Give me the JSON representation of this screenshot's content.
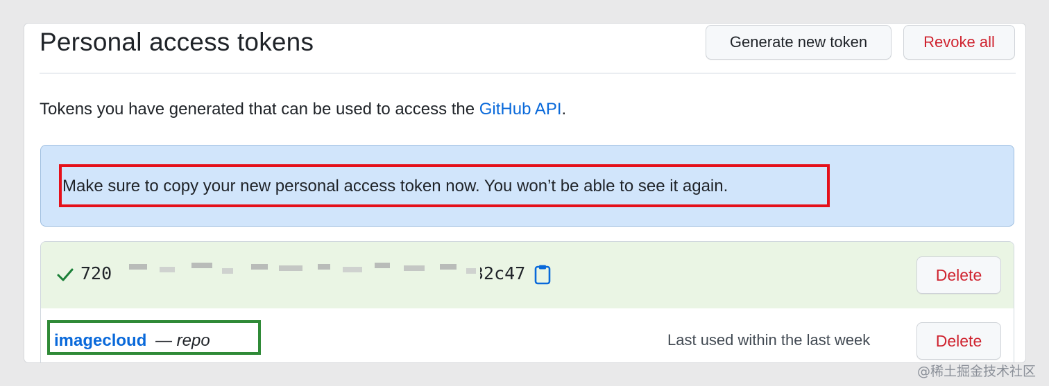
{
  "header": {
    "title": "Personal access tokens",
    "generate_label": "Generate new token",
    "revoke_label": "Revoke all"
  },
  "description": {
    "text": "Tokens you have generated that can be used to access the ",
    "link": "GitHub API",
    "suffix": "."
  },
  "flash": {
    "message": "Make sure to copy your new personal access token now. You won’t be able to see it again."
  },
  "tokens": {
    "new_token": {
      "prefix": "720",
      "suffix": "32c47",
      "delete_label": "Delete"
    },
    "existing": {
      "name": "imagecloud",
      "scope": "— repo",
      "last_used": "Last used within the last week",
      "delete_label": "Delete"
    }
  },
  "watermark": "@稀土掘金技术社区",
  "colors": {
    "accent_link": "#0969da",
    "danger": "#cf222e",
    "flash_bg": "#d1e5fb",
    "success_bg": "#eaf5e4",
    "highlight_red": "#e5101a",
    "highlight_green": "#2f8a37"
  },
  "icons": [
    "check-icon",
    "clipboard-icon"
  ]
}
